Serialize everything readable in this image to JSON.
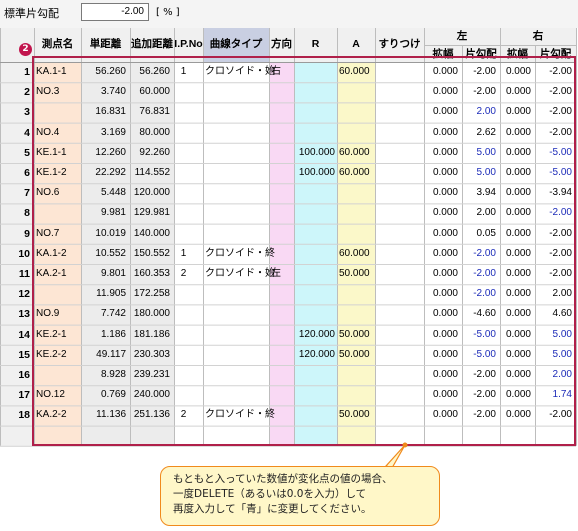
{
  "toolbar": {
    "label": "標準片勾配",
    "value": "-2.00",
    "unit": "[ % ]"
  },
  "badge": "2",
  "headers": {
    "point_name": "測点名",
    "single_distance": "単距離",
    "cumulative_distance": "追加距離",
    "ip_no": "I.P.No",
    "curve_type": "曲線タイプ",
    "direction": "方向",
    "r": "R",
    "a": "A",
    "transition": "すりつけ",
    "left": "左",
    "right": "右",
    "widening": "拡幅",
    "crossfall": "片勾配"
  },
  "rows": [
    {
      "no": "1",
      "name": "KA.1-1",
      "dist": "56.260",
      "add": "56.260",
      "ip": "1",
      "curve": "クロソイド・始",
      "dir": "右",
      "r": "",
      "a": "60.000",
      "trans": "",
      "lw": "0.000",
      "ls": "-2.00",
      "lsb": false,
      "rw": "0.000",
      "rs": "-2.00",
      "rsb": false
    },
    {
      "no": "2",
      "name": "NO.3",
      "dist": "3.740",
      "add": "60.000",
      "ip": "",
      "curve": "",
      "dir": "",
      "r": "",
      "a": "",
      "trans": "",
      "lw": "0.000",
      "ls": "-2.00",
      "lsb": false,
      "rw": "0.000",
      "rs": "-2.00",
      "rsb": false
    },
    {
      "no": "3",
      "name": "",
      "dist": "16.831",
      "add": "76.831",
      "ip": "",
      "curve": "",
      "dir": "",
      "r": "",
      "a": "",
      "trans": "",
      "lw": "0.000",
      "ls": "2.00",
      "lsb": true,
      "rw": "0.000",
      "rs": "-2.00",
      "rsb": false
    },
    {
      "no": "4",
      "name": "NO.4",
      "dist": "3.169",
      "add": "80.000",
      "ip": "",
      "curve": "",
      "dir": "",
      "r": "",
      "a": "",
      "trans": "",
      "lw": "0.000",
      "ls": "2.62",
      "lsb": false,
      "rw": "0.000",
      "rs": "-2.00",
      "rsb": false
    },
    {
      "no": "5",
      "name": "KE.1-1",
      "dist": "12.260",
      "add": "92.260",
      "ip": "",
      "curve": "",
      "dir": "",
      "r": "100.000",
      "a": "60.000",
      "trans": "",
      "lw": "0.000",
      "ls": "5.00",
      "lsb": true,
      "rw": "0.000",
      "rs": "-5.00",
      "rsb": true
    },
    {
      "no": "6",
      "name": "KE.1-2",
      "dist": "22.292",
      "add": "114.552",
      "ip": "",
      "curve": "",
      "dir": "",
      "r": "100.000",
      "a": "60.000",
      "trans": "",
      "lw": "0.000",
      "ls": "5.00",
      "lsb": true,
      "rw": "0.000",
      "rs": "-5.00",
      "rsb": true
    },
    {
      "no": "7",
      "name": "NO.6",
      "dist": "5.448",
      "add": "120.000",
      "ip": "",
      "curve": "",
      "dir": "",
      "r": "",
      "a": "",
      "trans": "",
      "lw": "0.000",
      "ls": "3.94",
      "lsb": false,
      "rw": "0.000",
      "rs": "-3.94",
      "rsb": false
    },
    {
      "no": "8",
      "name": "",
      "dist": "9.981",
      "add": "129.981",
      "ip": "",
      "curve": "",
      "dir": "",
      "r": "",
      "a": "",
      "trans": "",
      "lw": "0.000",
      "ls": "2.00",
      "lsb": false,
      "rw": "0.000",
      "rs": "-2.00",
      "rsb": true
    },
    {
      "no": "9",
      "name": "NO.7",
      "dist": "10.019",
      "add": "140.000",
      "ip": "",
      "curve": "",
      "dir": "",
      "r": "",
      "a": "",
      "trans": "",
      "lw": "0.000",
      "ls": "0.05",
      "lsb": false,
      "rw": "0.000",
      "rs": "-2.00",
      "rsb": false
    },
    {
      "no": "10",
      "name": "KA.1-2",
      "dist": "10.552",
      "add": "150.552",
      "ip": "1",
      "curve": "クロソイド・終",
      "dir": "",
      "r": "",
      "a": "60.000",
      "trans": "",
      "lw": "0.000",
      "ls": "-2.00",
      "lsb": true,
      "rw": "0.000",
      "rs": "-2.00",
      "rsb": false
    },
    {
      "no": "11",
      "name": "KA.2-1",
      "dist": "9.801",
      "add": "160.353",
      "ip": "2",
      "curve": "クロソイド・始",
      "dir": "左",
      "r": "",
      "a": "50.000",
      "trans": "",
      "lw": "0.000",
      "ls": "-2.00",
      "lsb": true,
      "rw": "0.000",
      "rs": "-2.00",
      "rsb": false
    },
    {
      "no": "12",
      "name": "",
      "dist": "11.905",
      "add": "172.258",
      "ip": "",
      "curve": "",
      "dir": "",
      "r": "",
      "a": "",
      "trans": "",
      "lw": "0.000",
      "ls": "-2.00",
      "lsb": true,
      "rw": "0.000",
      "rs": "2.00",
      "rsb": false
    },
    {
      "no": "13",
      "name": "NO.9",
      "dist": "7.742",
      "add": "180.000",
      "ip": "",
      "curve": "",
      "dir": "",
      "r": "",
      "a": "",
      "trans": "",
      "lw": "0.000",
      "ls": "-4.60",
      "lsb": false,
      "rw": "0.000",
      "rs": "4.60",
      "rsb": false
    },
    {
      "no": "14",
      "name": "KE.2-1",
      "dist": "1.186",
      "add": "181.186",
      "ip": "",
      "curve": "",
      "dir": "",
      "r": "120.000",
      "a": "50.000",
      "trans": "",
      "lw": "0.000",
      "ls": "-5.00",
      "lsb": true,
      "rw": "0.000",
      "rs": "5.00",
      "rsb": true
    },
    {
      "no": "15",
      "name": "KE.2-2",
      "dist": "49.117",
      "add": "230.303",
      "ip": "",
      "curve": "",
      "dir": "",
      "r": "120.000",
      "a": "50.000",
      "trans": "",
      "lw": "0.000",
      "ls": "-5.00",
      "lsb": true,
      "rw": "0.000",
      "rs": "5.00",
      "rsb": true
    },
    {
      "no": "16",
      "name": "",
      "dist": "8.928",
      "add": "239.231",
      "ip": "",
      "curve": "",
      "dir": "",
      "r": "",
      "a": "",
      "trans": "",
      "lw": "0.000",
      "ls": "-2.00",
      "lsb": false,
      "rw": "0.000",
      "rs": "2.00",
      "rsb": true
    },
    {
      "no": "17",
      "name": "NO.12",
      "dist": "0.769",
      "add": "240.000",
      "ip": "",
      "curve": "",
      "dir": "",
      "r": "",
      "a": "",
      "trans": "",
      "lw": "0.000",
      "ls": "-2.00",
      "lsb": false,
      "rw": "0.000",
      "rs": "1.74",
      "rsb": true
    },
    {
      "no": "18",
      "name": "KA.2-2",
      "dist": "11.136",
      "add": "251.136",
      "ip": "2",
      "curve": "クロソイド・終",
      "dir": "",
      "r": "",
      "a": "50.000",
      "trans": "",
      "lw": "0.000",
      "ls": "-2.00",
      "lsb": false,
      "rw": "0.000",
      "rs": "-2.00",
      "rsb": false
    }
  ],
  "callout": {
    "line1": "もともと入っていた数値が変化点の値の場合、",
    "line2": "一度DELETE（あるいは0.0を入力）して",
    "line3": "再度入力して「青」に変更してください。"
  },
  "colors": {
    "name_col": "#fde6d4",
    "dist_col": "#ececec",
    "dir_col": "#f9d9f4",
    "r_col": "#cdf6fa",
    "a_col": "#fbf8c9",
    "blue_value": "#1c2bb8",
    "header_bg": "#f0f0f0",
    "dir_header_bg": "#c9cfe2",
    "frame": "#b0204a"
  }
}
